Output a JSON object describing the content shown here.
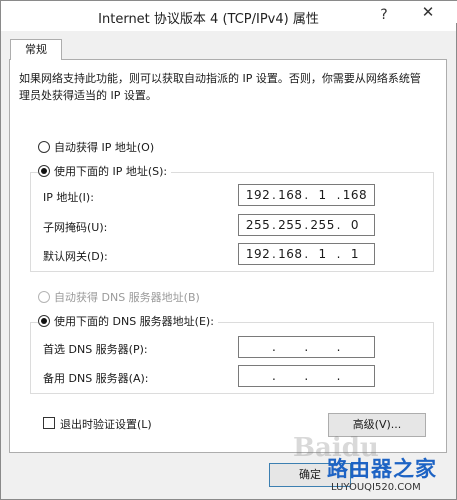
{
  "window": {
    "title": "Internet 协议版本 4 (TCP/IPv4) 属性",
    "help_glyph": "?",
    "close_glyph": "✕"
  },
  "tabs": [
    {
      "label": "常规"
    }
  ],
  "description": "如果网络支持此功能，则可以获取自动指派的 IP 设置。否则，你需要从网络系统管理员处获得适当的 IP 设置。",
  "ip_mode": {
    "auto_label": "自动获得 IP 地址(O)",
    "manual_label": "使用下面的 IP 地址(S):",
    "selected": "manual"
  },
  "ip_fields": [
    {
      "label": "IP 地址(I):",
      "octets": [
        "192",
        "168",
        "1",
        "168"
      ]
    },
    {
      "label": "子网掩码(U):",
      "octets": [
        "255",
        "255",
        "255",
        "0"
      ]
    },
    {
      "label": "默认网关(D):",
      "octets": [
        "192",
        "168",
        "1",
        "1"
      ]
    }
  ],
  "dns_mode": {
    "auto_label": "自动获得 DNS 服务器地址(B)",
    "manual_label": "使用下面的 DNS 服务器地址(E):",
    "selected": "manual"
  },
  "dns_fields": [
    {
      "label": "首选 DNS 服务器(P):",
      "octets": [
        "",
        "",
        "",
        ""
      ]
    },
    {
      "label": "备用 DNS 服务器(A):",
      "octets": [
        "",
        "",
        "",
        ""
      ]
    }
  ],
  "validate_label": "退出时验证设置(L)",
  "validate_checked": false,
  "buttons": {
    "advanced": "高级(V)...",
    "ok": "确定"
  },
  "watermark": {
    "baidu": "Baidu",
    "logo": "路由器之家",
    "url": "LUYOUQI520.COM"
  }
}
